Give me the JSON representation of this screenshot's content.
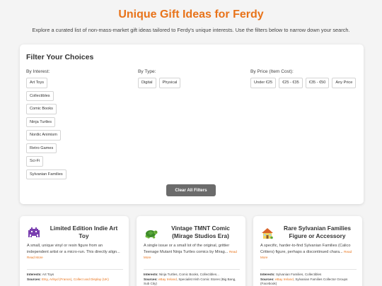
{
  "header": {
    "title": "Unique Gift Ideas for Ferdy",
    "subtitle": "Explore a curated list of non-mass-market gift ideas tailored to Ferdy's unique interests. Use the filters below to narrow down your search."
  },
  "filters": {
    "heading": "Filter Your Choices",
    "interest_label": "By Interest:",
    "interests": [
      "Art Toys",
      "Collectibles",
      "Comic Books",
      "Ninja Turtles",
      "Nordic Animism",
      "Retro Games",
      "Sci-Fi",
      "Sylvanian Families"
    ],
    "type_label": "By Type:",
    "types": [
      "Digital",
      "Physical"
    ],
    "price_label": "By Price (Item Cost):",
    "prices": [
      "Under €25",
      "€25 - €35",
      "€35 - €50",
      "Any Price"
    ],
    "clear_label": "Clear All Filters"
  },
  "cards": [
    {
      "icon": "alien-monster-icon",
      "title": "Limited Edition Indie Art Toy",
      "description": "A small, unique vinyl or resin figure from an independent artist or a micro-run. This directly align...",
      "read_more": "Read More",
      "interests_label": "Interests:",
      "interests": "Art Toys",
      "sources_label": "Sources:",
      "sources": [
        "Etsy",
        "Arlsyd (France)",
        "Collect and Display (UK)"
      ]
    },
    {
      "icon": "turtle-icon",
      "title": "Vintage TMNT Comic (Mirage Studios Era)",
      "description": "A single issue or a small lot of the original, grittier Teenage Mutant Ninja Turtles comics by Mirag...",
      "read_more": "Read More",
      "interests_label": "Interests:",
      "interests": "Ninja Turtles, Comic Books, Collectibles...",
      "sources_label": "Sources:",
      "sources": [
        "eBay Ireland",
        "Specialist Irish Comic Stores (Big Bang, Sub City)"
      ]
    },
    {
      "icon": "house-icon",
      "title": "Rare Sylvanian Families Figure or Accessory",
      "description": "A specific, harder-to-find Sylvanian Families (Calico Critters) figure, perhaps a discontinued chara...",
      "read_more": "Read More",
      "interests_label": "Interests:",
      "interests": "Sylvanian Families, Collectibles",
      "sources_label": "Sources:",
      "sources": [
        "eBay Ireland",
        "Sylvanian Families Collector Groups (Facebook)"
      ]
    }
  ],
  "colors": {
    "accent": "#e8731a",
    "button": "#6b6b6b",
    "background": "#f4f4f4"
  }
}
